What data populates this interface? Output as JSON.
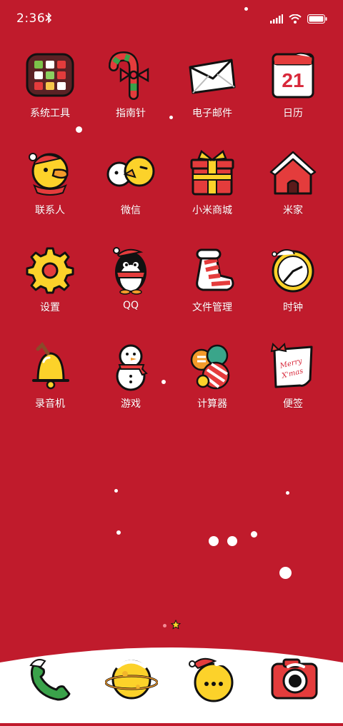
{
  "status_bar": {
    "time": "2:36",
    "bluetooth_icon": "bluetooth-icon",
    "signal_icon": "cellular-signal-icon",
    "wifi_icon": "wifi-icon",
    "battery_icon": "battery-icon"
  },
  "apps": [
    {
      "label": "系统工具",
      "icon": "folder-icon"
    },
    {
      "label": "指南针",
      "icon": "candy-cane-icon"
    },
    {
      "label": "电子邮件",
      "icon": "envelope-icon"
    },
    {
      "label": "日历",
      "icon": "calendar-icon",
      "date": "21"
    },
    {
      "label": "联系人",
      "icon": "duck-santa-icon"
    },
    {
      "label": "微信",
      "icon": "chat-birds-icon"
    },
    {
      "label": "小米商城",
      "icon": "gift-box-icon"
    },
    {
      "label": "米家",
      "icon": "snow-house-icon"
    },
    {
      "label": "设置",
      "icon": "gear-icon"
    },
    {
      "label": "QQ",
      "icon": "penguin-icon"
    },
    {
      "label": "文件管理",
      "icon": "stocking-icon"
    },
    {
      "label": "时钟",
      "icon": "clock-icon"
    },
    {
      "label": "录音机",
      "icon": "bell-icon"
    },
    {
      "label": "游戏",
      "icon": "snowman-icon"
    },
    {
      "label": "计算器",
      "icon": "ornaments-icon"
    },
    {
      "label": "便签",
      "icon": "note-icon",
      "note_text": "Merry X'mas"
    }
  ],
  "dock": [
    {
      "icon": "phone-icon"
    },
    {
      "icon": "planet-icon"
    },
    {
      "icon": "message-bubble-icon"
    },
    {
      "icon": "camera-icon"
    }
  ],
  "page_indicator": {
    "pages": 2,
    "current": 1,
    "home_icon": "star-icon"
  },
  "colors": {
    "background": "#c01b2c",
    "dock": "#ffffff",
    "accent_yellow": "#fcd22a"
  }
}
